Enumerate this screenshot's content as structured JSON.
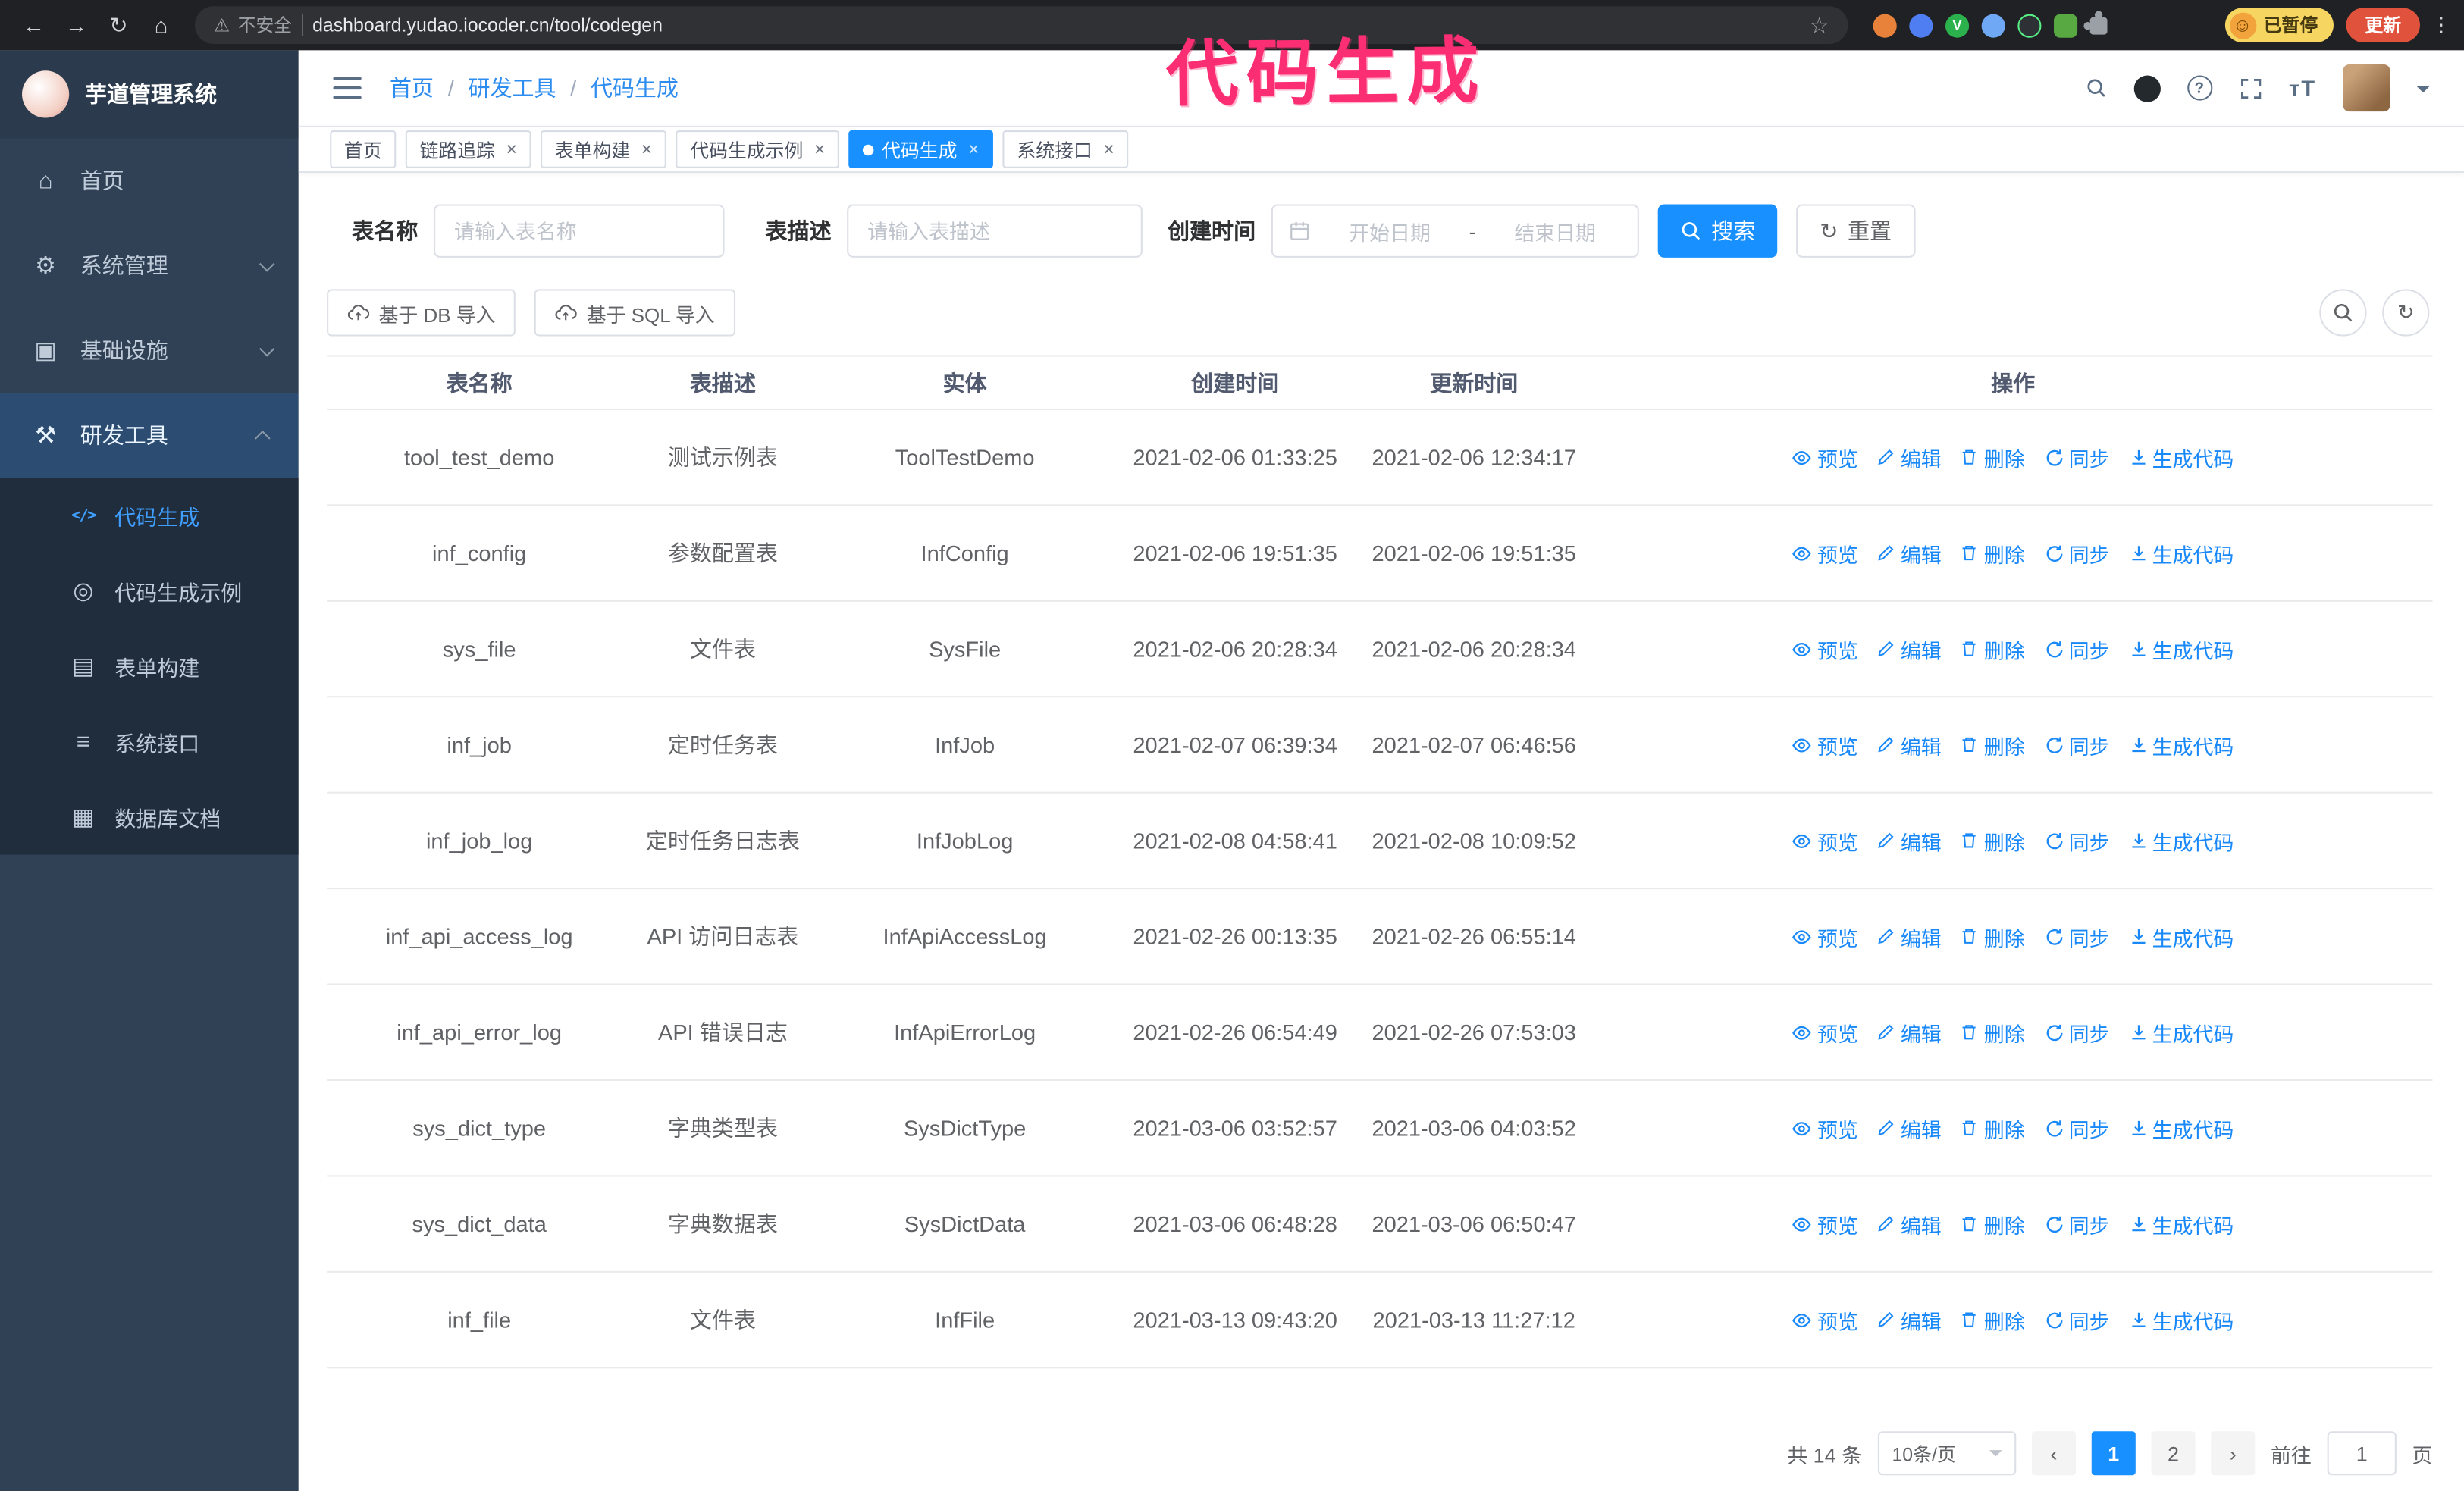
{
  "icons": {
    "back": "←",
    "forward": "→",
    "reload": "↻",
    "home": "⌂",
    "warning": "⚠",
    "star": "☆",
    "smiley": "☺",
    "kebab": "⋮",
    "close": "×",
    "prev": "‹",
    "next": "›",
    "sync": "↻",
    "question": "?",
    "font_size": "тT",
    "ext_letter": "V"
  },
  "browser": {
    "security_warning": "不安全",
    "url": "dashboard.yudao.iocoder.cn/tool/codegen",
    "paused_badge": "已暂停",
    "update_button": "更新"
  },
  "annotation": {
    "text": "代码生成",
    "color": "#fb2e73"
  },
  "sidebar": {
    "logo_title": "芋道管理系统",
    "items": [
      {
        "key": "home",
        "label": "首页",
        "icon": "dashboard-icon",
        "glyph": "⌂"
      },
      {
        "key": "system",
        "label": "系统管理",
        "icon": "gear-icon",
        "glyph": "⚙",
        "chevron": "down"
      },
      {
        "key": "infrastructure",
        "label": "基础设施",
        "icon": "infrastructure-icon",
        "glyph": "▣",
        "chevron": "down"
      },
      {
        "key": "dev-tools",
        "label": "研发工具",
        "icon": "tools-icon",
        "glyph": "⚒",
        "chevron": "up",
        "highlight": true
      }
    ],
    "submenu": [
      {
        "key": "codegen",
        "label": "代码生成",
        "icon": "code-icon",
        "glyph": "</>",
        "active": true
      },
      {
        "key": "codegen-example",
        "label": "代码生成示例",
        "icon": "example-icon",
        "glyph": "◎"
      },
      {
        "key": "form-builder",
        "label": "表单构建",
        "icon": "form-icon",
        "glyph": "▤"
      },
      {
        "key": "api",
        "label": "系统接口",
        "icon": "api-icon",
        "glyph": "≡"
      },
      {
        "key": "db-doc",
        "label": "数据库文档",
        "icon": "database-icon",
        "glyph": "▦"
      }
    ]
  },
  "header": {
    "breadcrumb": [
      "首页",
      "研发工具",
      "代码生成"
    ],
    "separator": "/"
  },
  "tabs": [
    {
      "key": "home",
      "label": "首页",
      "closable": false
    },
    {
      "key": "tracing",
      "label": "链路追踪",
      "closable": true
    },
    {
      "key": "form-builder",
      "label": "表单构建",
      "closable": true
    },
    {
      "key": "codegen-example",
      "label": "代码生成示例",
      "closable": true
    },
    {
      "key": "codegen",
      "label": "代码生成",
      "closable": true,
      "active": true
    },
    {
      "key": "api",
      "label": "系统接口",
      "closable": true
    }
  ],
  "filters": {
    "name_label": "表名称",
    "name_placeholder": "请输入表名称",
    "desc_label": "表描述",
    "desc_placeholder": "请输入表描述",
    "time_label": "创建时间",
    "start_placeholder": "开始日期",
    "separator": "-",
    "end_placeholder": "结束日期",
    "search_button": "搜索",
    "reset_button": "重置"
  },
  "toolbar": {
    "import_db": "基于 DB 导入",
    "import_sql": "基于 SQL 导入"
  },
  "table": {
    "columns": [
      "表名称",
      "表描述",
      "实体",
      "创建时间",
      "更新时间",
      "操作"
    ],
    "op_labels": [
      "预览",
      "编辑",
      "删除",
      "同步",
      "生成代码"
    ],
    "rows": [
      [
        "tool_test_demo",
        "测试示例表",
        "ToolTestDemo",
        "2021-02-06 01:33:25",
        "2021-02-06 12:34:17"
      ],
      [
        "inf_config",
        "参数配置表",
        "InfConfig",
        "2021-02-06 19:51:35",
        "2021-02-06 19:51:35"
      ],
      [
        "sys_file",
        "文件表",
        "SysFile",
        "2021-02-06 20:28:34",
        "2021-02-06 20:28:34"
      ],
      [
        "inf_job",
        "定时任务表",
        "InfJob",
        "2021-02-07 06:39:34",
        "2021-02-07 06:46:56"
      ],
      [
        "inf_job_log",
        "定时任务日志表",
        "InfJobLog",
        "2021-02-08 04:58:41",
        "2021-02-08 10:09:52"
      ],
      [
        "inf_api_access_log",
        "API 访问日志表",
        "InfApiAccessLog",
        "2021-02-26 00:13:35",
        "2021-02-26 06:55:14"
      ],
      [
        "inf_api_error_log",
        "API 错误日志",
        "InfApiErrorLog",
        "2021-02-26 06:54:49",
        "2021-02-26 07:53:03"
      ],
      [
        "sys_dict_type",
        "字典类型表",
        "SysDictType",
        "2021-03-06 03:52:57",
        "2021-03-06 04:03:52"
      ],
      [
        "sys_dict_data",
        "字典数据表",
        "SysDictData",
        "2021-03-06 06:48:28",
        "2021-03-06 06:50:47"
      ],
      [
        "inf_file",
        "文件表",
        "InfFile",
        "2021-03-13 09:43:20",
        "2021-03-13 11:27:12"
      ]
    ]
  },
  "pagination": {
    "total": "共 14 条",
    "page_size": "10条/页",
    "pages": [
      "1",
      "2"
    ],
    "active_page": "1",
    "goto_label": "前往",
    "goto_value": "1",
    "page_unit": "页"
  },
  "colors": {
    "accent": "#1890ff",
    "sidebar_bg": "#304156",
    "submenu_bg": "#1f2d3d",
    "active_link": "#409eff"
  }
}
